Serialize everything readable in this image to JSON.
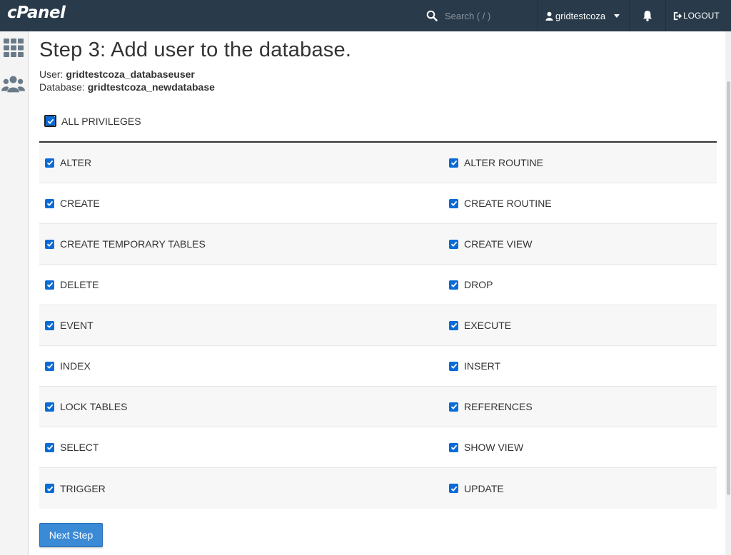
{
  "header": {
    "logo_text": "cPanel",
    "search_placeholder": "Search ( / )",
    "username": "gridtestcoza",
    "logout_label": "LOGOUT"
  },
  "sidebar": {
    "items": [
      {
        "icon": "grid-icon"
      },
      {
        "icon": "users-icon"
      }
    ]
  },
  "main": {
    "title": "Step 3: Add user to the database.",
    "user_label": "User:",
    "user_value": "gridtestcoza_databaseuser",
    "database_label": "Database:",
    "database_value": "gridtestcoza_newdatabase",
    "all_privileges_label": "ALL PRIVILEGES",
    "all_privileges_checked": true,
    "privileges": [
      [
        "ALTER",
        "ALTER ROUTINE"
      ],
      [
        "CREATE",
        "CREATE ROUTINE"
      ],
      [
        "CREATE TEMPORARY TABLES",
        "CREATE VIEW"
      ],
      [
        "DELETE",
        "DROP"
      ],
      [
        "EVENT",
        "EXECUTE"
      ],
      [
        "INDEX",
        "INSERT"
      ],
      [
        "LOCK TABLES",
        "REFERENCES"
      ],
      [
        "SELECT",
        "SHOW VIEW"
      ],
      [
        "TRIGGER",
        "UPDATE"
      ]
    ],
    "next_button_label": "Next Step"
  },
  "colors": {
    "topbar": "#293a4a",
    "checkbox": "#0b6bd6",
    "button": "#3a8ad6"
  }
}
